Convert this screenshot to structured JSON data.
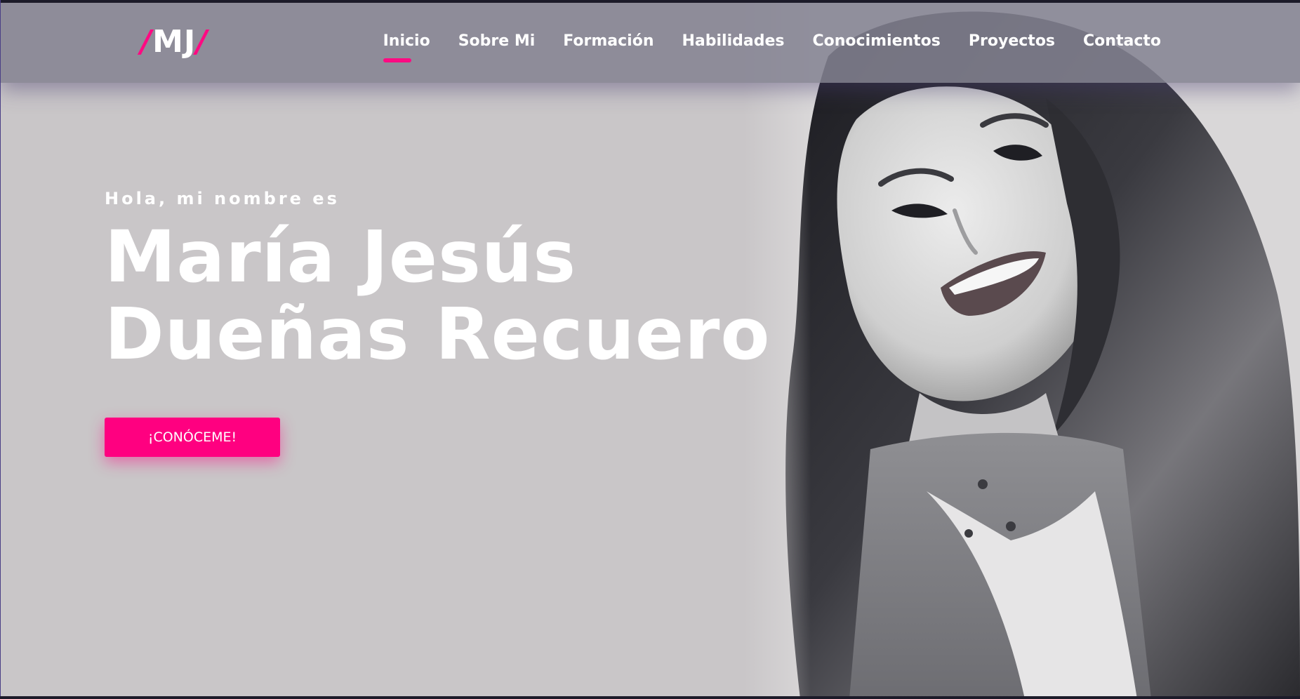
{
  "colors": {
    "accent": "#ff0a82",
    "button": "#ff0080",
    "navbar": "#848292",
    "hero_background": "#c9c6c8",
    "text": "#ffffff"
  },
  "logo": {
    "slash_left": "/",
    "letters": "MJ",
    "slash_right": "/"
  },
  "nav": {
    "items": [
      {
        "label": "Inicio",
        "active": true
      },
      {
        "label": "Sobre Mi",
        "active": false
      },
      {
        "label": "Formación",
        "active": false
      },
      {
        "label": "Habilidades",
        "active": false
      },
      {
        "label": "Conocimientos",
        "active": false
      },
      {
        "label": "Proyectos",
        "active": false
      },
      {
        "label": "Contacto",
        "active": false
      }
    ]
  },
  "hero": {
    "greeting": "Hola, mi nombre es",
    "name_line1": "María Jesús",
    "name_line2": "Dueñas Recuero",
    "cta_label": "¡CONÓCEME!",
    "photo_icon": "portrait-photo"
  }
}
